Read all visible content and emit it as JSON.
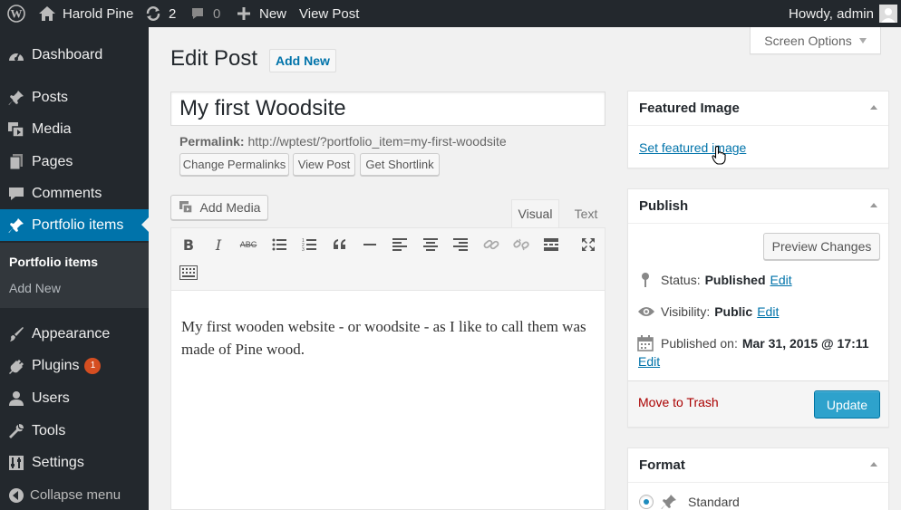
{
  "admin_bar": {
    "site_name": "Harold Pine",
    "updates_count": "2",
    "comments_count": "0",
    "new_label": "New",
    "view_post_label": "View Post",
    "howdy": "Howdy, admin"
  },
  "sidebar": {
    "items": [
      {
        "label": "Dashboard",
        "icon": "dashboard-icon"
      },
      {
        "label": "Posts",
        "icon": "pin-icon"
      },
      {
        "label": "Media",
        "icon": "media-icon"
      },
      {
        "label": "Pages",
        "icon": "pages-icon"
      },
      {
        "label": "Comments",
        "icon": "comment-icon"
      },
      {
        "label": "Portfolio items",
        "icon": "pin-icon"
      },
      {
        "label": "Appearance",
        "icon": "brush-icon"
      },
      {
        "label": "Plugins",
        "icon": "plug-icon",
        "badge": "1"
      },
      {
        "label": "Users",
        "icon": "users-icon"
      },
      {
        "label": "Tools",
        "icon": "wrench-icon"
      },
      {
        "label": "Settings",
        "icon": "settings-icon"
      }
    ],
    "submenu": [
      "Portfolio items",
      "Add New"
    ],
    "collapse_label": "Collapse menu"
  },
  "screen_options": "Screen Options",
  "page": {
    "title": "Edit Post",
    "add_new": "Add New"
  },
  "post": {
    "title": "My first Woodsite",
    "permalink_label": "Permalink:",
    "permalink_url": "http://wptest/?portfolio_item=my-first-woodsite",
    "btn_change_permalinks": "Change Permalinks",
    "btn_view_post": "View Post",
    "btn_get_shortlink": "Get Shortlink",
    "add_media": "Add Media",
    "tab_visual": "Visual",
    "tab_text": "Text",
    "content": "My first wooden website - or woodsite - as I like to call them was made of Pine wood."
  },
  "featured_image": {
    "title": "Featured Image",
    "link": "Set featured image"
  },
  "publish": {
    "title": "Publish",
    "preview": "Preview Changes",
    "status_label": "Status:",
    "status_value": "Published",
    "visibility_label": "Visibility:",
    "visibility_value": "Public",
    "published_label": "Published on:",
    "published_value": "Mar 31, 2015 @ 17:11",
    "edit": "Edit",
    "trash": "Move to Trash",
    "update": "Update"
  },
  "format": {
    "title": "Format",
    "option": "Standard"
  },
  "colors": {
    "accent": "#0073aa",
    "sidebar_bg": "#23282d",
    "primary_btn": "#2ea2cc",
    "trash": "#a00"
  }
}
